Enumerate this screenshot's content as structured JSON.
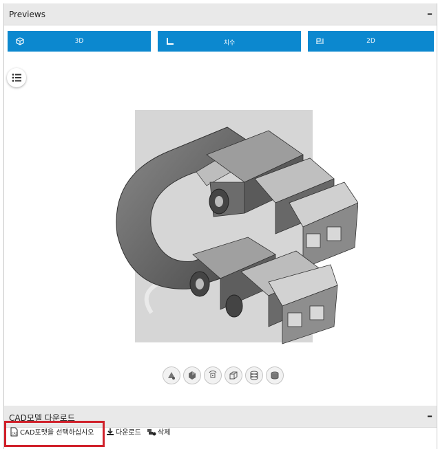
{
  "previews_panel": {
    "title": "Previews",
    "collapse_symbol": "–",
    "tabs": [
      {
        "label": "3D",
        "icon": "cube-icon"
      },
      {
        "label": "치수",
        "icon": "dimension-icon"
      },
      {
        "label": "2D",
        "icon": "drawing-icon"
      }
    ],
    "view_buttons": [
      "view-iso-icon",
      "view-shaded-icon",
      "view-rotate-icon",
      "view-box-icon",
      "view-wireframe-icon",
      "view-solid-icon"
    ]
  },
  "cad_panel": {
    "title": "CAD모델 다운로드",
    "collapse_symbol": "–",
    "select_format": "CAD포맷을 선택하십시오",
    "download": "다운로드",
    "delete": "삭제"
  },
  "colors": {
    "tab_blue": "#0c88cf",
    "highlight_red": "#d0202a",
    "header_gray": "#e9e9e9"
  }
}
